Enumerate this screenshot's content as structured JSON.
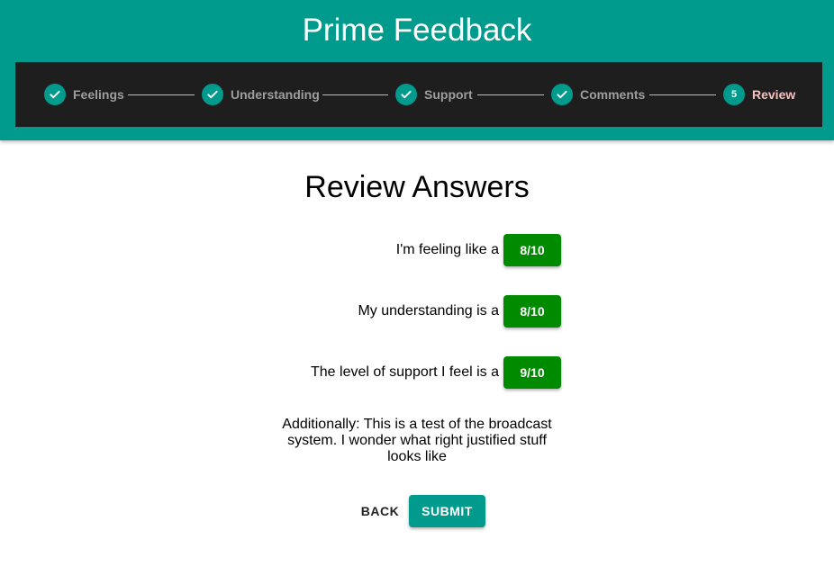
{
  "app": {
    "title": "Prime Feedback"
  },
  "stepper": {
    "steps": [
      {
        "label": "Feelings",
        "status": "completed",
        "icon": "check-icon"
      },
      {
        "label": "Understanding",
        "status": "completed",
        "icon": "check-icon"
      },
      {
        "label": "Support",
        "status": "completed",
        "icon": "check-icon"
      },
      {
        "label": "Comments",
        "status": "completed",
        "icon": "check-icon"
      },
      {
        "label": "Review",
        "status": "active",
        "number": "5"
      }
    ]
  },
  "review": {
    "title": "Review Answers",
    "answers": [
      {
        "label": "I'm feeling like a",
        "score": "8/10"
      },
      {
        "label": "My understanding is a",
        "score": "8/10"
      },
      {
        "label": "The level of support I feel is a",
        "score": "9/10"
      }
    ],
    "comments": "Additionally: This is a test of the broadcast system. I wonder what right justified stuff looks like"
  },
  "actions": {
    "back_label": "BACK",
    "submit_label": "SUBMIT"
  },
  "colors": {
    "primary": "#009b8d",
    "stepper_bg": "#1e1e1e",
    "score_badge": "#008a00",
    "active_step_label": "#f9c0c0"
  }
}
